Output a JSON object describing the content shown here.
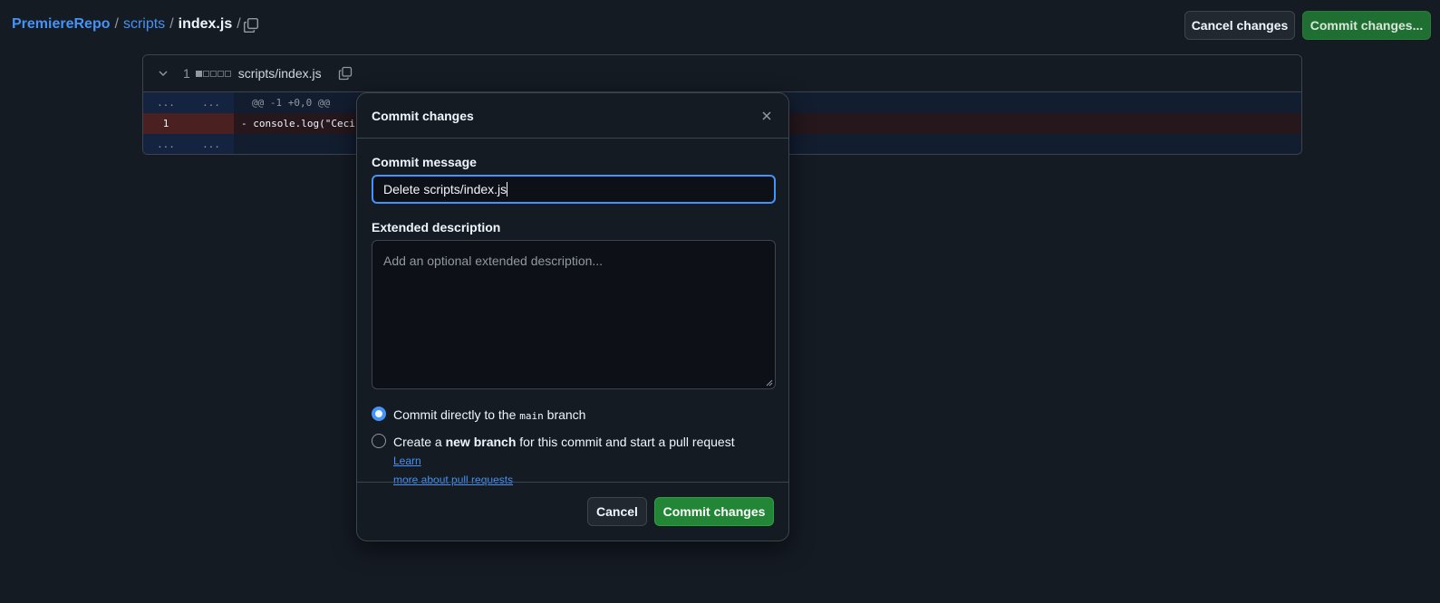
{
  "breadcrumb": {
    "repo": "PremiereRepo",
    "folder": "scripts",
    "file": "index.js",
    "trailing_sep": "/"
  },
  "toolbar": {
    "cancel_label": "Cancel changes",
    "commit_label": "Commit changes..."
  },
  "diff": {
    "count": "1",
    "filename": "scripts/index.js",
    "hunk_ellipsis_left": "...",
    "hunk_ellipsis_right": "...",
    "hunk_header": "@@ -1 +0,0 @@",
    "deleted_line_number": "1",
    "deleted_line": "- console.log(\"Ceci",
    "end_ellipsis_left": "...",
    "end_ellipsis_right": "..."
  },
  "modal": {
    "title": "Commit changes",
    "message_label": "Commit message",
    "message_value": "Delete scripts/index.js",
    "description_label": "Extended description",
    "description_placeholder": "Add an optional extended description...",
    "option1_prefix": "Commit directly to the",
    "option1_branch": "main",
    "option1_suffix": "branch",
    "option2_prefix": "Create a",
    "option2_bold": "new branch",
    "option2_suffix": "for this commit and start a pull request",
    "learn_more_1": "Learn",
    "learn_more_2": "more about pull requests",
    "cancel_label": "Cancel",
    "commit_label": "Commit changes"
  },
  "colors": {
    "accent": "#4493f8",
    "success": "#238636",
    "background": "#151b23"
  }
}
